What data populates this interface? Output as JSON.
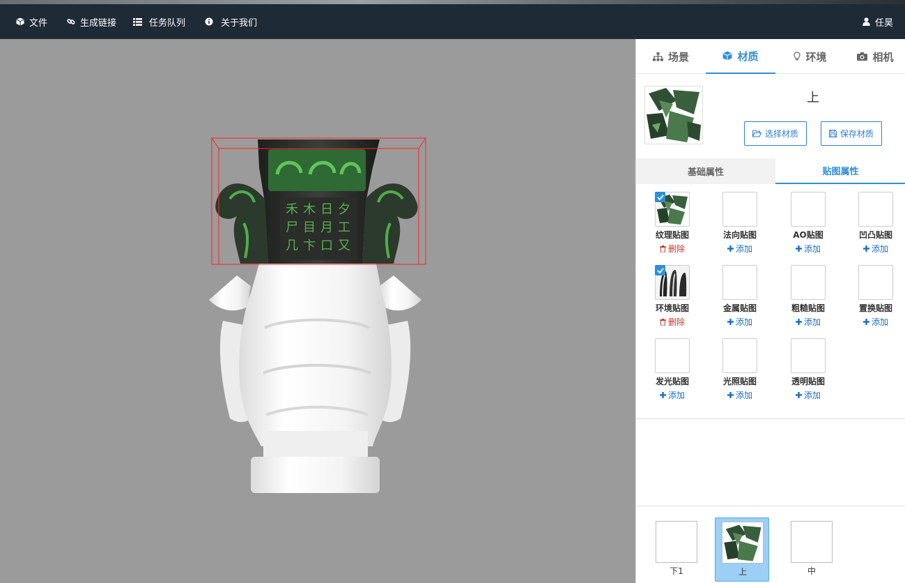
{
  "navbar": {
    "items": [
      {
        "icon": "cube-icon",
        "label": "文件"
      },
      {
        "icon": "link-icon",
        "label": "生成链接"
      },
      {
        "icon": "list-icon",
        "label": "任务队列"
      },
      {
        "icon": "info-icon",
        "label": "关于我们"
      }
    ],
    "user": {
      "icon": "user-icon",
      "label": "任昊"
    }
  },
  "panel": {
    "tabs": [
      {
        "icon": "sitemap-icon",
        "label": "场景",
        "active": false
      },
      {
        "icon": "cube-icon",
        "label": "材质",
        "active": true
      },
      {
        "icon": "lightbulb-icon",
        "label": "环境",
        "active": false
      },
      {
        "icon": "camera-icon",
        "label": "相机",
        "active": false
      }
    ],
    "material": {
      "name": "上",
      "select_button": "选择材质",
      "save_button": "保存材质"
    },
    "subtabs": [
      {
        "label": "基础属性",
        "active": false
      },
      {
        "label": "贴图属性",
        "active": true
      }
    ],
    "maps": [
      {
        "label": "纹理贴图",
        "action": "删除",
        "filled": true,
        "thumb": "texture"
      },
      {
        "label": "法向贴图",
        "action": "添加",
        "filled": false
      },
      {
        "label": "AO贴图",
        "action": "添加",
        "filled": false
      },
      {
        "label": "凹凸贴图",
        "action": "添加",
        "filled": false
      },
      {
        "label": "环境贴图",
        "action": "删除",
        "filled": true,
        "thumb": "envmap"
      },
      {
        "label": "金属贴图",
        "action": "添加",
        "filled": false
      },
      {
        "label": "粗糙贴图",
        "action": "添加",
        "filled": false
      },
      {
        "label": "置换贴图",
        "action": "添加",
        "filled": false
      },
      {
        "label": "发光贴图",
        "action": "添加",
        "filled": false
      },
      {
        "label": "光照贴图",
        "action": "添加",
        "filled": false
      },
      {
        "label": "透明贴图",
        "action": "添加",
        "filled": false
      }
    ],
    "meshes": [
      {
        "label": "下1",
        "selected": false,
        "filled": false
      },
      {
        "label": "上",
        "selected": true,
        "filled": true
      },
      {
        "label": "中",
        "selected": false,
        "filled": false
      }
    ]
  },
  "colors": {
    "navbar": "#1f2a37",
    "viewport": "#9b9b9b",
    "accent": "#2f8fd8",
    "delete": "#c0392b",
    "selection_box": "#ff2020"
  }
}
